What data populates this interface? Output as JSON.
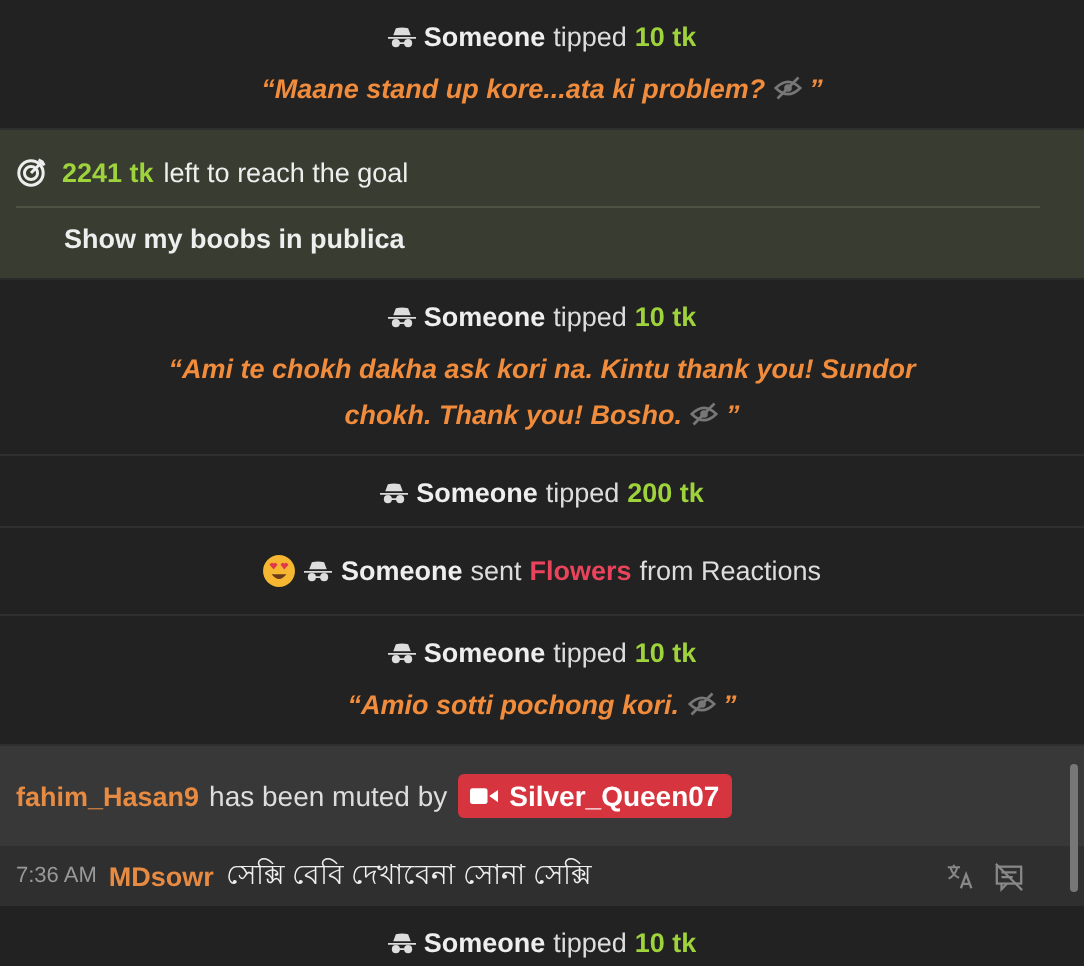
{
  "messages": [
    {
      "kind": "tip",
      "user": "Someone",
      "verb": "tipped",
      "amount": "10 tk",
      "quote": [
        "“Maane stand up kore...ata ki problem?"
      ],
      "quote_end": "”"
    },
    {
      "kind": "goal",
      "amount": "2241 tk",
      "text": "left to reach the goal",
      "goal": "Show my boobs in publica"
    },
    {
      "kind": "tip",
      "user": "Someone",
      "verb": "tipped",
      "amount": "10 tk",
      "quote": [
        "“Ami te chokh dakha ask kori na. Kintu thank you! Sundor",
        "chokh. Thank you! Bosho."
      ],
      "quote_end": "”"
    },
    {
      "kind": "tip",
      "user": "Someone",
      "verb": "tipped",
      "amount": "200 tk"
    },
    {
      "kind": "reaction",
      "user": "Someone",
      "verb": "sent",
      "gift": "Flowers",
      "source": "from Reactions"
    },
    {
      "kind": "tip",
      "user": "Someone",
      "verb": "tipped",
      "amount": "10 tk",
      "quote": [
        "“Amio sotti pochong kori."
      ],
      "quote_end": "”"
    },
    {
      "kind": "muted",
      "user": "fahim_Hasan9",
      "text": "has been muted by",
      "by": "Silver_Queen07"
    },
    {
      "kind": "chat",
      "time": "7:36 AM",
      "user": "MDsowr",
      "text": "সেক্সি বেবি দেখাবেনা সোনা সেক্সি"
    },
    {
      "kind": "tip",
      "user": "Someone",
      "verb": "tipped",
      "amount": "10 tk"
    }
  ]
}
